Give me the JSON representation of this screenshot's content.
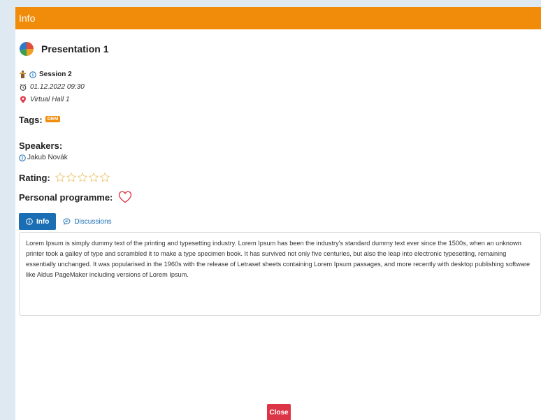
{
  "header": {
    "title": "Info"
  },
  "presentation": {
    "title": "Presentation 1",
    "session": "Session 2",
    "datetime": "01.12.2022 09:30",
    "location": "Virtual Hall 1"
  },
  "tags": {
    "label": "Tags:",
    "items": [
      "DEM"
    ]
  },
  "speakers": {
    "label": "Speakers:",
    "items": [
      "Jakub Novák"
    ]
  },
  "rating": {
    "label": "Rating:",
    "value": 0,
    "max": 5
  },
  "personal": {
    "label": "Personal programme:"
  },
  "tabs": {
    "info": "Info",
    "discussions": "Discussions"
  },
  "description": "Lorem Ipsum is simply dummy text of the printing and typesetting industry. Lorem Ipsum has been the industry's standard dummy text ever since the 1500s, when an unknown printer took a galley of type and scrambled it to make a type specimen book. It has survived not only five centuries, but also the leap into electronic typesetting, remaining essentially unchanged. It was popularised in the 1960s with the release of Letraset sheets containing Lorem Ipsum passages, and more recently with desktop publishing software like Aldus PageMaker including versions of Lorem Ipsum.",
  "footer": {
    "close_label": "Close"
  },
  "colors": {
    "header": "#f08c0a",
    "primary": "#1b6eb4",
    "danger": "#dc3545",
    "tag": "#f08c0a",
    "heart": "#e0394b",
    "star": "#e9c46a"
  },
  "icons": {
    "presentation": "pie-chart-icon",
    "session": "podium-icon",
    "info": "info-icon",
    "time": "alarm-clock-icon",
    "location": "map-pin-icon",
    "favorite": "heart-icon",
    "rating": "star-icon",
    "discussion": "chat-bubble-icon"
  }
}
